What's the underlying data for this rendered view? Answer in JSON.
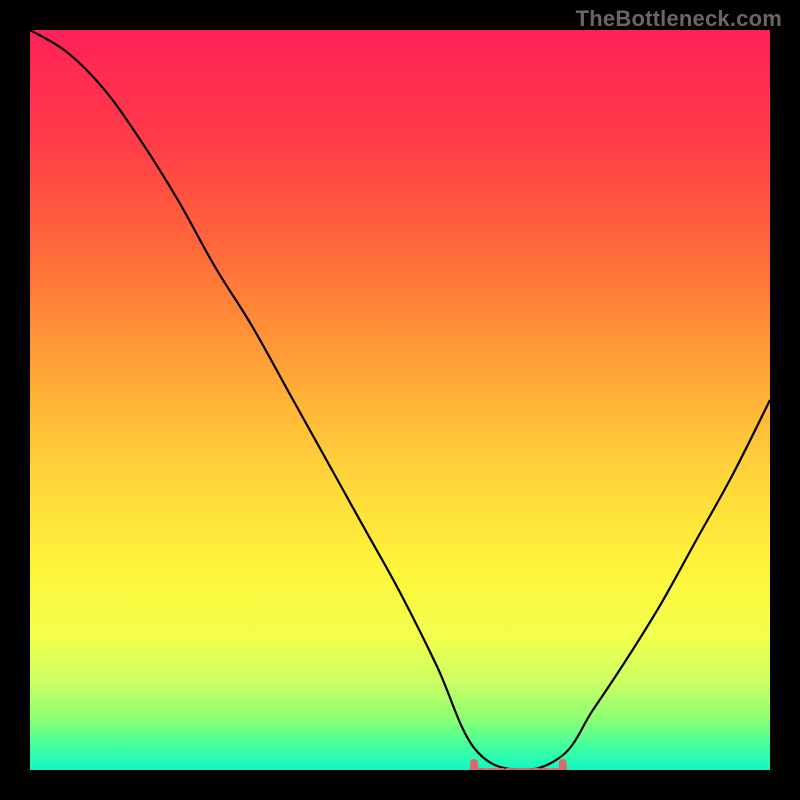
{
  "watermark": "TheBottleneck.com",
  "colors": {
    "black": "#000000",
    "curve": "#000000",
    "marker": "#d96a6a",
    "grad_stops": [
      {
        "o": 0.0,
        "c": "#ff2158"
      },
      {
        "o": 0.15,
        "c": "#ff3c48"
      },
      {
        "o": 0.3,
        "c": "#ff6a3a"
      },
      {
        "o": 0.45,
        "c": "#ffa036"
      },
      {
        "o": 0.6,
        "c": "#ffd43a"
      },
      {
        "o": 0.73,
        "c": "#fff53b"
      },
      {
        "o": 0.82,
        "c": "#f2ff4d"
      },
      {
        "o": 0.88,
        "c": "#cdff63"
      },
      {
        "o": 0.93,
        "c": "#8dff70"
      },
      {
        "o": 0.97,
        "c": "#3effa2"
      },
      {
        "o": 1.0,
        "c": "#14f5c4"
      }
    ]
  },
  "chart_data": {
    "type": "line",
    "title": "",
    "xlabel": "",
    "ylabel": "",
    "xlim": [
      0,
      100
    ],
    "ylim": [
      0,
      100
    ],
    "grid": false,
    "notes": "V-shaped bottleneck curve on a vertical rainbow heat gradient background. The curve reaches its minimum (≈0) on a flat segment between x≈60 and x≈72, then rises again. Short salmon-colored tick markers sit at the two ends of that flat minimum segment.",
    "series": [
      {
        "name": "bottleneck",
        "x": [
          0,
          5,
          10,
          15,
          20,
          25,
          30,
          35,
          40,
          45,
          50,
          55,
          60,
          66,
          72,
          76,
          80,
          85,
          90,
          95,
          100
        ],
        "values": [
          100,
          97,
          92,
          85,
          77,
          68,
          60,
          51,
          42,
          33,
          24,
          14,
          3,
          0,
          2,
          8,
          14,
          22,
          31,
          40,
          50
        ]
      }
    ],
    "flat_min": {
      "x_start": 60,
      "x_end": 72,
      "y": 0
    }
  }
}
